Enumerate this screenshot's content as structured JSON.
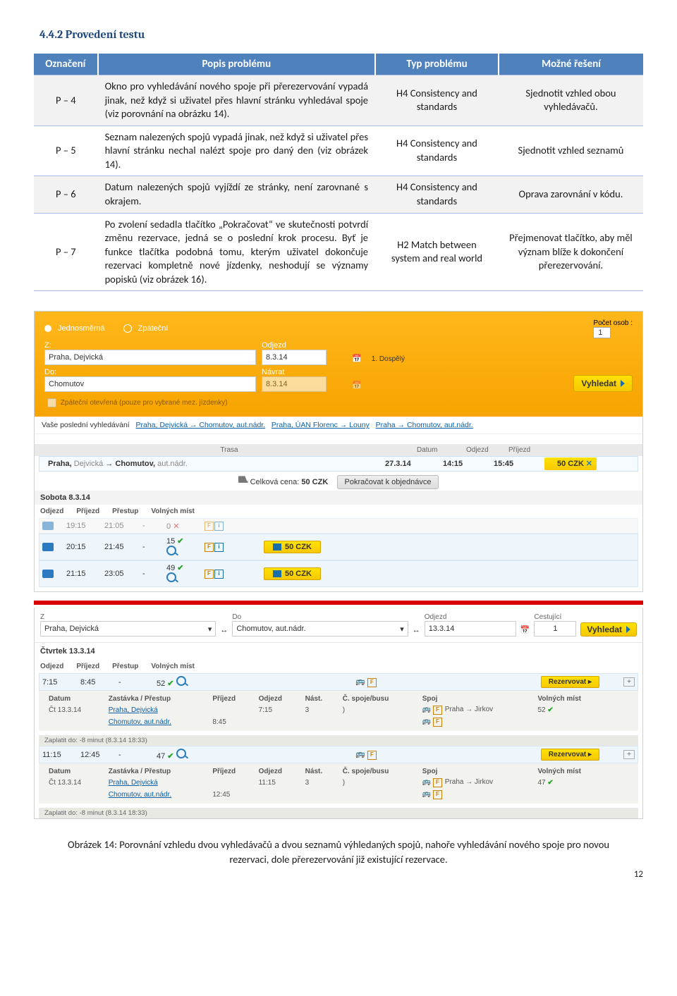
{
  "heading": "4.4.2  Provedení testu",
  "table": {
    "headers": [
      "Označení",
      "Popis problému",
      "Typ problému",
      "Možné řešení"
    ],
    "rows": [
      {
        "id": "P – 4",
        "desc": "Okno pro vyhledávání nového spoje při přerezervování vypadá jinak, než když si uživatel přes hlavní stránku vyhledával spoje (viz porovnání na obrázku 14).",
        "type": "H4 Consistency and standards",
        "fix": "Sjednotit vzhled obou vyhledávačů."
      },
      {
        "id": "P – 5",
        "desc": "Seznam nalezených spojů vypadá jinak, než když si uživatel přes hlavní stránku nechal nalézt spoje pro daný den (viz obrázek 14).",
        "type": "H4 Consistency and standards",
        "fix": "Sjednotit vzhled seznamů"
      },
      {
        "id": "P – 6",
        "desc": "Datum nalezených spojů vyjíždí ze stránky, není zarovnané s okrajem.",
        "type": "H4 Consistency and standards",
        "fix": "Oprava zarovnání v kódu."
      },
      {
        "id": "P – 7",
        "desc": "Po zvolení sedadla tlačítko „Pokračovat“ ve skutečnosti potvrdí změnu rezervace, jedná se o poslední krok procesu. Byť je funkce tlačítka podobná tomu, kterým uživatel dokončuje rezervaci kompletně nové jízdenky, neshodují se významy popisků (viz obrázek 16).",
        "type": "H2 Match between system and real world",
        "fix": "Přejmenovat tlačítko, aby měl význam blíže k dokončení přerezervování."
      }
    ]
  },
  "screenshot": {
    "direction_labels": {
      "oneway": "Jednosměrná",
      "return": "Zpáteční"
    },
    "from_label": "Z:",
    "from_value": "Praha, Dejvická",
    "to_label": "Do:",
    "to_value": "Chomutov",
    "depart_label": "Odjezd",
    "return_label": "Návrat",
    "date_out": "8.3.14",
    "date_back": "8.3.14",
    "persons_label": "Počet osob :",
    "persons_value": "1",
    "tariff_line": "1.  Dospělý",
    "openreturn_label": "Zpáteční otevřená (pouze pro vybrané mez. jízdenky)",
    "search_btn": "Vyhledat",
    "history_label": "Vaše poslední vyhledávání",
    "history_items": [
      "Praha, Dejvická → Chomutov, aut.nádr.",
      "Praha, ÚAN Florenc → Louny",
      "Praha → Chomutov, aut.nádr."
    ],
    "routehead": [
      "Trasa",
      "Datum",
      "Odjezd",
      "Příjezd"
    ],
    "route_text_from": "Praha, ",
    "route_text_from2": "Dejvická",
    "route_arrow": "→",
    "route_text_to": "Chomutov, ",
    "route_text_to2": "aut.nádr.",
    "route_date": "27.3.14",
    "route_dep": "14:15",
    "route_arr": "15:45",
    "route_price": "50 CZK",
    "cart_total_label": "Celková cena:",
    "cart_total_value": "50 CZK",
    "checkout_btn": "Pokračovat k objednávce",
    "day_label": "Sobota 8.3.14",
    "sched_head": [
      "Odjezd",
      "Příjezd",
      "Přestup",
      "Volných míst"
    ],
    "sched_rows": [
      {
        "dep": "19:15",
        "arr": "21:05",
        "trans": "-",
        "seats": "0",
        "price": "",
        "disabled": true
      },
      {
        "dep": "20:15",
        "arr": "21:45",
        "trans": "-",
        "seats": "15",
        "price": "50 CZK",
        "disabled": false
      },
      {
        "dep": "21:15",
        "arr": "23:05",
        "trans": "-",
        "seats": "49",
        "price": "50 CZK",
        "disabled": false
      }
    ],
    "search2": {
      "from_label": "Z",
      "from": "Praha, Dejvická",
      "to_label": "Do",
      "to": "Chomutov, aut.nádr.",
      "date_label": "Odjezd",
      "date": "13.3.14",
      "pax_label": "Cestující",
      "pax": "1",
      "btn": "Vyhledat"
    },
    "day2": "Čtvrtek 13.3.14",
    "sched2_head": [
      "Odjezd",
      "Příjezd",
      "Přestup",
      "Volných míst"
    ],
    "sched2_rows": [
      {
        "dep": "7:15",
        "arr": "8:45",
        "trans": "-",
        "seats": "52",
        "btn": "Rezervovat"
      },
      {
        "dep": "11:15",
        "arr": "12:45",
        "trans": "-",
        "seats": "47",
        "btn": "Rezervovat"
      }
    ],
    "detail_head": [
      "Datum",
      "Zastávka / Přestup",
      "Příjezd",
      "Odjezd",
      "Nást.",
      "Č. spoje/busu",
      "Spoj",
      "Volných míst"
    ],
    "detail1": [
      {
        "date": "Čt 13.3.14",
        "stop": "Praha, Dejvická",
        "arr": "",
        "dep": "7:15",
        "plat": "3",
        "busno": ")",
        "spoj": "Praha → Jirkov",
        "seats": "52"
      },
      {
        "date": "",
        "stop": "Chomutov, aut.nádr.",
        "arr": "8:45",
        "dep": "",
        "plat": "",
        "busno": "",
        "spoj": "",
        "seats": ""
      }
    ],
    "detail2": [
      {
        "date": "Čt 13.3.14",
        "stop": "Praha, Dejvická",
        "arr": "",
        "dep": "11:15",
        "plat": "3",
        "busno": ")",
        "spoj": "Praha → Jirkov",
        "seats": "47"
      },
      {
        "date": "",
        "stop": "Chomutov, aut.nádr.",
        "arr": "12:45",
        "dep": "",
        "plat": "",
        "busno": "",
        "spoj": "",
        "seats": ""
      }
    ],
    "paynote": "Zaplatit do: -8 minut (8.3.14 18:33)"
  },
  "caption": "Obrázek 14: Porovnání vzhledu dvou vyhledávačů a dvou seznamů výhledaných spojů, nahoře vyhledávání nového spoje pro novou rezervaci, dole přerezervování již existující rezervace.",
  "pagenum": "12"
}
